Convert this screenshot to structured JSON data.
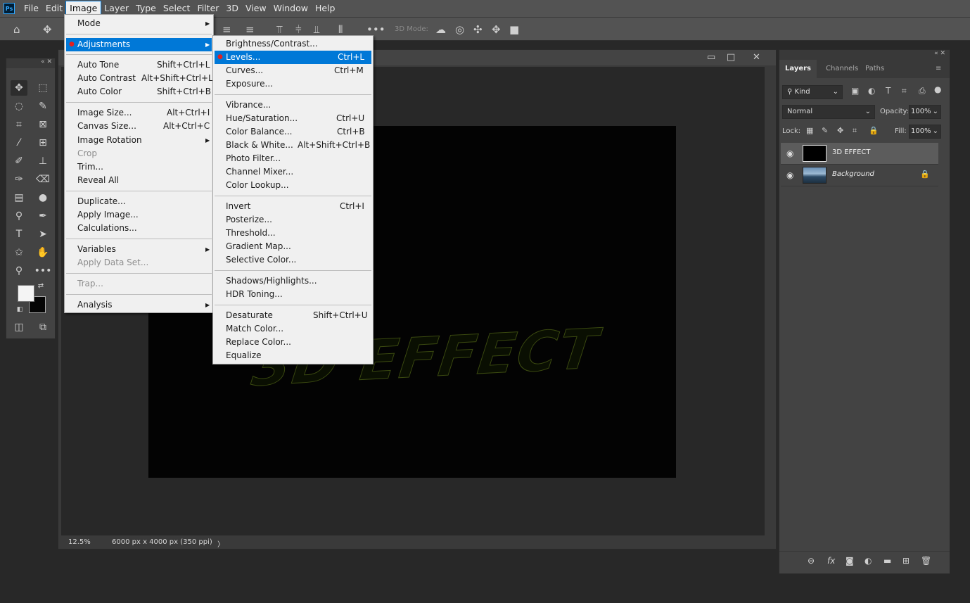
{
  "app": {
    "logo": "Ps"
  },
  "menubar": [
    "File",
    "Edit",
    "Image",
    "Layer",
    "Type",
    "Select",
    "Filter",
    "3D",
    "View",
    "Window",
    "Help"
  ],
  "optionsbar": {
    "mode_label": "3D Mode:"
  },
  "document": {
    "canvas_text": "3D EFFECT",
    "status": {
      "zoom": "12.5%",
      "info": "6000 px x 4000 px (350 ppi)",
      "arrow": "〉"
    },
    "window_controls": {
      "minimize": "▭",
      "restore": "□",
      "close": "✕"
    }
  },
  "image_menu": {
    "items": [
      {
        "label": "Mode",
        "submenu": true
      },
      {
        "label": "Adjustments",
        "submenu": true,
        "highlight": true
      },
      {
        "label": "Auto Tone",
        "shortcut": "Shift+Ctrl+L"
      },
      {
        "label": "Auto Contrast",
        "shortcut": "Alt+Shift+Ctrl+L"
      },
      {
        "label": "Auto Color",
        "shortcut": "Shift+Ctrl+B"
      },
      {
        "label": "Image Size...",
        "shortcut": "Alt+Ctrl+I"
      },
      {
        "label": "Canvas Size...",
        "shortcut": "Alt+Ctrl+C"
      },
      {
        "label": "Image Rotation",
        "submenu": true
      },
      {
        "label": "Crop",
        "disabled": true
      },
      {
        "label": "Trim..."
      },
      {
        "label": "Reveal All"
      },
      {
        "label": "Duplicate..."
      },
      {
        "label": "Apply Image..."
      },
      {
        "label": "Calculations..."
      },
      {
        "label": "Variables",
        "submenu": true
      },
      {
        "label": "Apply Data Set...",
        "disabled": true
      },
      {
        "label": "Trap...",
        "disabled": true
      },
      {
        "label": "Analysis",
        "submenu": true
      }
    ]
  },
  "adjustments_menu": {
    "items": [
      {
        "label": "Brightness/Contrast..."
      },
      {
        "label": "Levels...",
        "shortcut": "Ctrl+L",
        "highlight": true
      },
      {
        "label": "Curves...",
        "shortcut": "Ctrl+M"
      },
      {
        "label": "Exposure..."
      },
      {
        "label": "Vibrance..."
      },
      {
        "label": "Hue/Saturation...",
        "shortcut": "Ctrl+U"
      },
      {
        "label": "Color Balance...",
        "shortcut": "Ctrl+B"
      },
      {
        "label": "Black & White...",
        "shortcut": "Alt+Shift+Ctrl+B"
      },
      {
        "label": "Photo Filter..."
      },
      {
        "label": "Channel Mixer..."
      },
      {
        "label": "Color Lookup..."
      },
      {
        "label": "Invert",
        "shortcut": "Ctrl+I"
      },
      {
        "label": "Posterize..."
      },
      {
        "label": "Threshold..."
      },
      {
        "label": "Gradient Map..."
      },
      {
        "label": "Selective Color..."
      },
      {
        "label": "Shadows/Highlights..."
      },
      {
        "label": "HDR Toning..."
      },
      {
        "label": "Desaturate",
        "shortcut": "Shift+Ctrl+U"
      },
      {
        "label": "Match Color..."
      },
      {
        "label": "Replace Color..."
      },
      {
        "label": "Equalize"
      }
    ]
  },
  "layers_panel": {
    "tabs": [
      "Layers",
      "Channels",
      "Paths"
    ],
    "filter_kind": "Kind",
    "blend_mode": "Normal",
    "opacity_label": "Opacity:",
    "opacity": "100%",
    "lock_label": "Lock:",
    "fill_label": "Fill:",
    "fill": "100%",
    "layers": [
      {
        "name": "3D EFFECT"
      },
      {
        "name": "Background"
      }
    ]
  }
}
